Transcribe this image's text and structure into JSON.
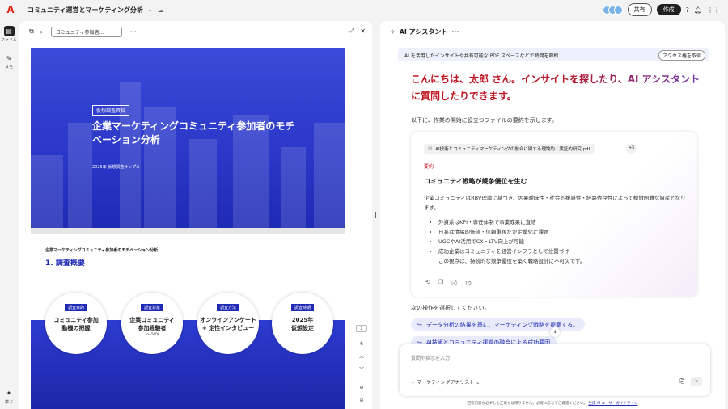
{
  "topbar": {
    "logo": "A",
    "title": "コミュニティ運営とマーケティング分析",
    "share": "共有",
    "create": "作成"
  },
  "rail": {
    "files": "ファイル",
    "memo": "メモ",
    "learn": "学ぶ"
  },
  "viewer": {
    "dropdown": "コミュニティ参加者…",
    "page_current": "1",
    "page_total": "6"
  },
  "cover": {
    "tag": "仮想調査資料",
    "title": "企業マーケティングコミュニティ参加者のモチベーション分析",
    "sub": "2025年 仮想調査サンプル"
  },
  "page2": {
    "header": "企業マーケティングコミュニティ参加者のモチベーション分析",
    "h1": "1. 調査概要",
    "circles": [
      {
        "tag": "調査目的",
        "text": "コミュニティ参加\n動機の把握",
        "small": ""
      },
      {
        "tag": "調査対象",
        "text": "企業コミュニティ\n参加経験者",
        "small": "(n=500)"
      },
      {
        "tag": "調査方法",
        "text": "オンラインアンケート\n+ 定性インタビュー",
        "small": ""
      },
      {
        "tag": "調査時期",
        "text": "2025年\n仮想設定",
        "small": ""
      }
    ]
  },
  "assistant": {
    "title": "AI アシスタント",
    "banner": "AI を活用したインサイトや共有可能な PDF スペースなどで時間を節約",
    "banner_btn": "アクセス権を取得",
    "greeting": "こんにちは、太郎 さん。インサイトを探したり、AI アシスタントに質問したりできます。",
    "intro": "以下に、作業の開始に役立つファイルの要約を示します。",
    "file_chip": "AI技術とコミュニティマーケティングの融合に関する理論的・実証的研究.pdf",
    "file_more": "+5",
    "summary_label": "要約",
    "summary_title": "コミュニティ戦略が競争優位を生む",
    "summary_body": "企業コミュニティはRBV理論に基づき、因果曖昧性・社会的複雑性・経路依存性によって模倣困難な資産となります。",
    "bullets": [
      "外資系はKPI・専任体制で事業成果に直結",
      "日系は情緒的価値・信頼重視だが定量化に課題",
      "UGCやAI活用でCX・LTV向上が可能",
      "成功企業はコミュニティを経営インフラとして位置づけ"
    ],
    "note": "この視点は、持続的な競争優位を築く戦略設計に不可欠です。",
    "prompt": "次の操作を選択してください。",
    "suggestions": [
      "データ分析の結果を基に、マーケティング戦略を提案する。",
      "AI技術とコミュニティ運営の融合による成功要因"
    ],
    "input_placeholder": "質問や指示を入力",
    "persona": "マーケティングアナリスト",
    "footer": "回答内容が必ずしも正確とは限りません。必要に応じてご確認ください。",
    "footer_link": "生成 AI ユーザーガイドライン"
  }
}
